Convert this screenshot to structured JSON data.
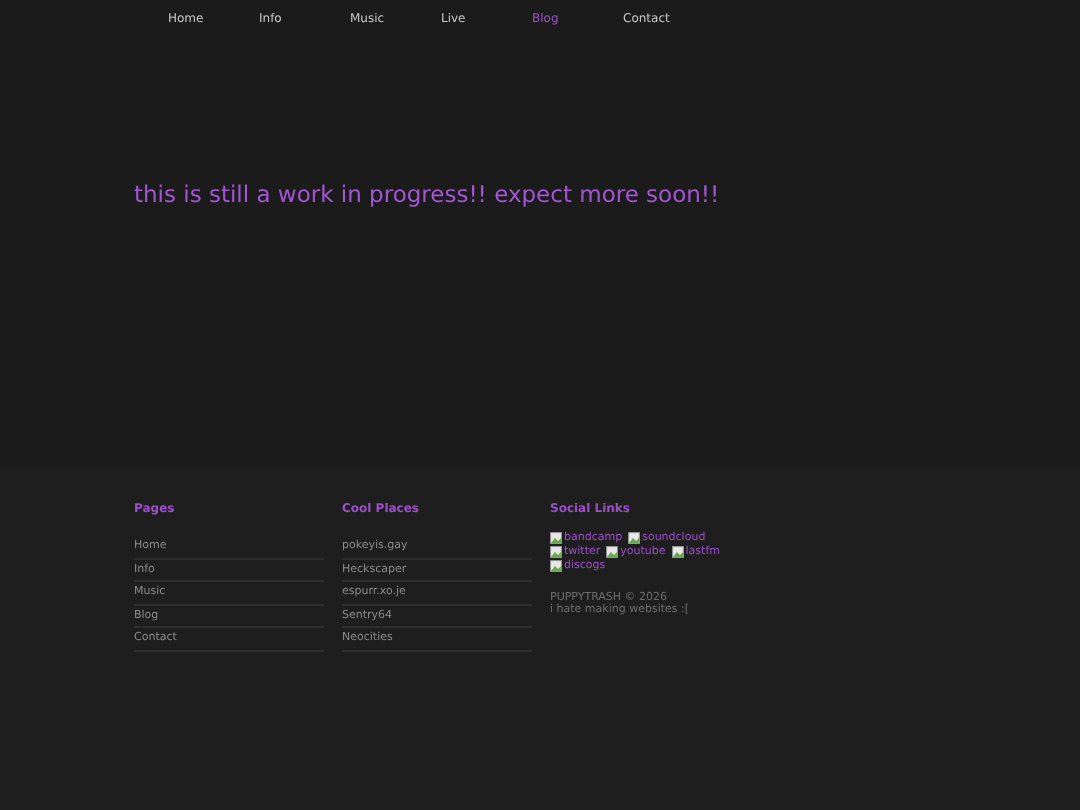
{
  "nav": [
    {
      "label": "Home",
      "selected": false
    },
    {
      "label": "Info",
      "selected": false
    },
    {
      "label": "Music",
      "selected": false
    },
    {
      "label": "Live",
      "selected": false
    },
    {
      "label": "Blog",
      "selected": true
    },
    {
      "label": "Contact",
      "selected": false
    }
  ],
  "main": {
    "heading": "this is still a work in progress!! expect more soon!!"
  },
  "footer": {
    "pages": {
      "title": "Pages",
      "items": [
        "Home",
        "Info",
        "Music",
        "Blog",
        "Contact"
      ]
    },
    "cool_places": {
      "title": "Cool Places",
      "items": [
        "pokeyis.gay",
        "Heckscaper",
        "espurr.xo.je",
        "Sentry64",
        "Neocities"
      ]
    },
    "social_links": {
      "title": "Social Links",
      "links": [
        "bandcamp",
        "soundcloud",
        "twitter",
        "youtube",
        "lastfm",
        "discogs"
      ],
      "copyright": "PUPPYTRASH © 2026",
      "note": "i hate making websites :["
    }
  }
}
